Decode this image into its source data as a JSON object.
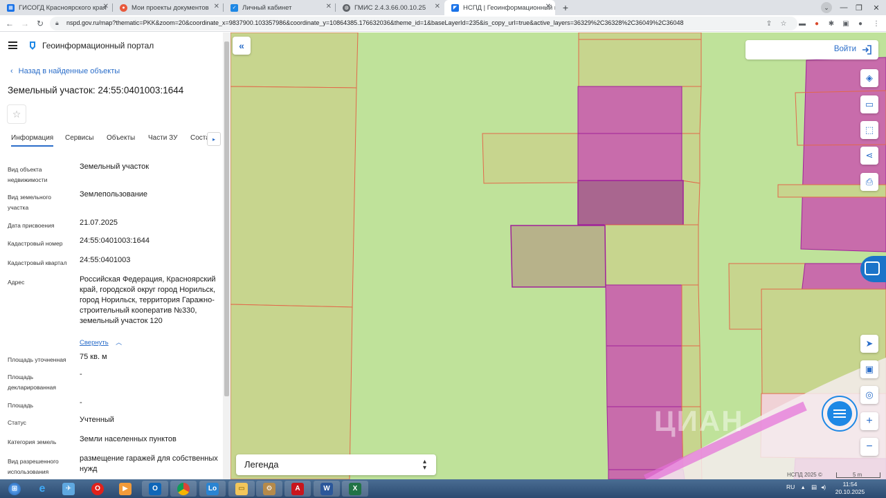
{
  "browser": {
    "tabs": [
      {
        "title": "ГИСОГД Красноярского края",
        "icon": "map-favicon",
        "active": false
      },
      {
        "title": "Мои проекты документов",
        "icon": "document-favicon",
        "active": false
      },
      {
        "title": "Личный кабинет",
        "icon": "cabinet-favicon",
        "active": false
      },
      {
        "title": "ГМИС 2.4.3.66.00.10.25",
        "icon": "globe-favicon",
        "active": false
      },
      {
        "title": "НСПД | Геоинформационный п",
        "icon": "nspd-favicon",
        "active": true
      }
    ],
    "new_tab_label": "+",
    "url": "nspd.gov.ru/map?thematic=PKK&zoom=20&coordinate_x=9837900.103357986&coordinate_y=10864385.176632036&theme_id=1&baseLayerId=235&is_copy_url=true&active_layers=36329%2C36328%2C36049%2C36048"
  },
  "header": {
    "title": "Геоинформационный портал"
  },
  "panel": {
    "back_label": "Назад в найденные объекты",
    "object_title": "Земельный участок: 24:55:0401003:1644",
    "tabs": [
      "Информация",
      "Сервисы",
      "Объекты",
      "Части ЗУ",
      "Состав"
    ],
    "collapse_label": "Свернуть",
    "fields": [
      {
        "label": "Вид объекта недвижимости",
        "value": "Земельный участок"
      },
      {
        "label": "Вид земельного участка",
        "value": "Землепользование"
      },
      {
        "label": "Дата присвоения",
        "value": "21.07.2025"
      },
      {
        "label": "Кадастровый номер",
        "value": "24:55:0401003:1644"
      },
      {
        "label": "Кадастровый квартал",
        "value": "24:55:0401003"
      },
      {
        "label": "Адрес",
        "value": "Российская Федерация, Красноярский край, городской округ город Норильск, город Норильск, территория Гаражно-строительный кооператив №330, земельный участок 120"
      },
      {
        "label": "Площадь уточненная",
        "value": "75 кв. м"
      },
      {
        "label": "Площадь декларированная",
        "value": "-"
      },
      {
        "label": "Площадь",
        "value": "-"
      },
      {
        "label": "Статус",
        "value": "Учтенный"
      },
      {
        "label": "Категория земель",
        "value": "Земли населенных пунктов"
      },
      {
        "label": "Вид разрешенного использования",
        "value": "размещение гаражей для собственных нужд"
      }
    ]
  },
  "map": {
    "login_label": "Войти",
    "legend_label": "Легенда",
    "attribution": "НСПД 2025 ©",
    "scale_label": "5 m",
    "watermark": "ЦИАН",
    "colors": {
      "background": "#bfe29a",
      "parcel_fill": "#c7d58e",
      "parcel_stroke": "#e2684a",
      "building_fill": "#c86cab",
      "building_stroke": "#a0209a",
      "selected_fill": "#a9668f",
      "accent": "#2a6dc9"
    }
  },
  "taskbar": {
    "apps": [
      "start",
      "ie",
      "outlook-bird",
      "opera",
      "media",
      "outlook",
      "chrome",
      "lo",
      "explorer",
      "archive",
      "acrobat",
      "word",
      "excel"
    ],
    "language": "RU",
    "time": "11:54",
    "date": "20.10.2025"
  }
}
